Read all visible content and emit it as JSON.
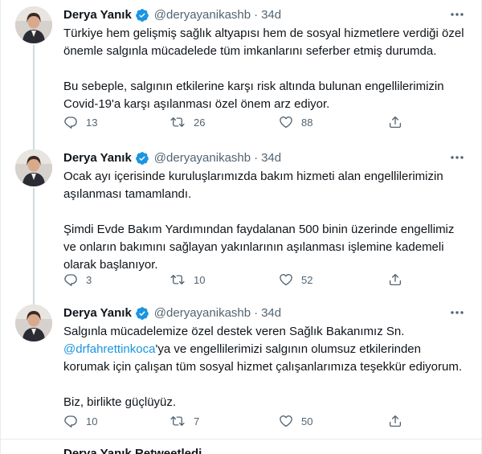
{
  "colors": {
    "accent": "#1b95e0",
    "muted": "#536471",
    "text": "#0f1419",
    "divider": "#e6ecf0"
  },
  "tweets": [
    {
      "author": "Derya Yanık",
      "handle": "@deryayanikashb",
      "separator": "·",
      "time": "34d",
      "paragraphs": [
        "Türkiye hem gelişmiş sağlık altyapısı hem de sosyal hizmetlere verdiği özel önemle salgınla mücadelede tüm imkanlarını seferber etmiş durumda.",
        "Bu sebeple, salgının etkilerine karşı risk altında bulunan engellilerimizin Covid-19'a karşı aşılanması özel önem arz ediyor."
      ],
      "replies": "13",
      "retweets": "26",
      "likes": "88"
    },
    {
      "author": "Derya Yanık",
      "handle": "@deryayanikashb",
      "separator": "·",
      "time": "34d",
      "paragraphs": [
        "Ocak ayı içerisinde kuruluşlarımızda bakım hizmeti alan engellilerimizin aşılanması tamamlandı.",
        "Şimdi Evde Bakım Yardımından faydalanan 500 binin üzerinde engellimiz ve onların bakımını sağlayan yakınlarının aşılanması işlemine kademeli olarak başlanıyor."
      ],
      "replies": "3",
      "retweets": "10",
      "likes": "52"
    },
    {
      "author": "Derya Yanık",
      "handle": "@deryayanikashb",
      "separator": "·",
      "time": "34d",
      "p1_before": "Salgınla mücadelemize özel destek veren Sağlık Bakanımız Sn. ",
      "mention": "@drfahrettinkoca",
      "p1_after": "'ya ve engellilerimizi salgının olumsuz etkilerinden korumak için çalışan tüm sosyal hizmet çalışanlarımıza teşekkür ediyorum.",
      "p2": "Biz, birlikte güçlüyüz.",
      "replies": "10",
      "retweets": "7",
      "likes": "50"
    }
  ],
  "next_row_text": "Derya Yanık Retweetledi",
  "icons": [
    "verified-badge-icon",
    "more-icon",
    "reply-icon",
    "retweet-icon",
    "like-icon",
    "share-icon"
  ]
}
